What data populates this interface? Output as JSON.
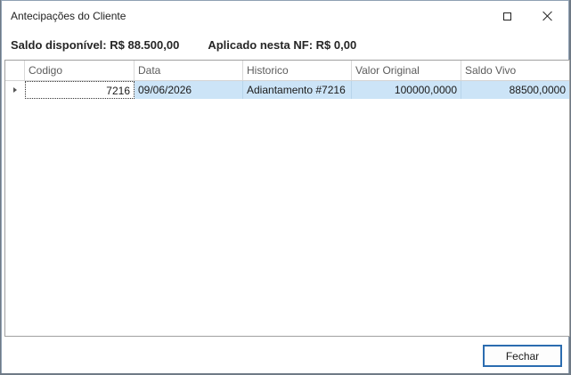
{
  "window": {
    "title": "Antecipações do Cliente"
  },
  "summary": {
    "saldo_label": "Saldo disponível: R$ 88.500,00",
    "aplicado_label": "Aplicado nesta NF: R$ 0,00"
  },
  "grid": {
    "columns": [
      "Codigo",
      "Data",
      "Historico",
      "Valor Original",
      "Saldo Vivo"
    ],
    "rows": [
      {
        "codigo": "7216",
        "data": "09/06/2026",
        "historico": "Adiantamento #7216",
        "valor_original": "100000,0000",
        "saldo_vivo": "88500,0000"
      }
    ]
  },
  "footer": {
    "close_label": "Fechar"
  },
  "colors": {
    "selection": "#cce4f7",
    "accent": "#2b6cb0"
  }
}
